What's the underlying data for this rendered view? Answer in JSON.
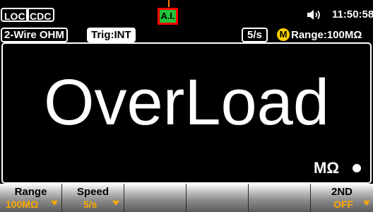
{
  "status": {
    "loc_label": "LOC",
    "cdc_label": "CDC",
    "ai_label": "A.I.",
    "time": "11:50:58"
  },
  "info": {
    "function": "2-Wire OHM",
    "trigger": "Trig:INT",
    "rate": "5/s",
    "manual_badge": "M",
    "range": "Range:100MΩ"
  },
  "display": {
    "reading": "OverLoad",
    "unit": "MΩ"
  },
  "softkeys": [
    {
      "title": "Range",
      "value": "100MΩ"
    },
    {
      "title": "Speed",
      "value": "5/s"
    },
    {
      "title": "",
      "value": ""
    },
    {
      "title": "",
      "value": ""
    },
    {
      "title": "",
      "value": ""
    },
    {
      "title": "2ND",
      "value": "OFF"
    }
  ],
  "colors": {
    "accent_orange": "#ffaa00",
    "ai_green": "#22c43a",
    "ai_border_red": "#ff0000",
    "manual_yellow": "#ffd000"
  }
}
